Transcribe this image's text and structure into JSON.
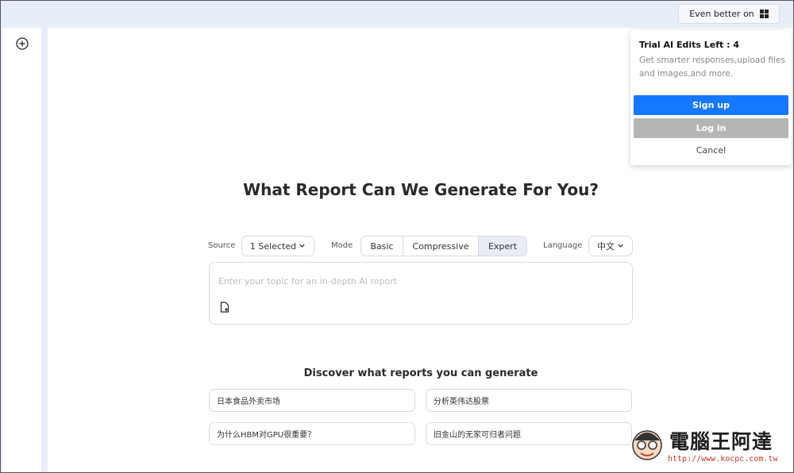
{
  "topbar": {
    "even_better_label": "Even better on",
    "even_better_icon": "windows-icon"
  },
  "left_rail": {
    "new_icon": "plus-circle-icon"
  },
  "main": {
    "title": "What Report Can We Generate For You?",
    "source": {
      "label": "Source",
      "value": "1 Selected"
    },
    "mode": {
      "label": "Mode",
      "options": [
        "Basic",
        "Compressive",
        "Expert"
      ],
      "selected": "Expert"
    },
    "language": {
      "label": "Language",
      "value": "中文"
    },
    "topic": {
      "placeholder": "Enter your topic for an in-depth AI report",
      "value": ""
    },
    "discover": {
      "title": "Discover what reports you can generate",
      "suggestions": [
        "日本食品外卖市场",
        "分析英伟达股票",
        "为什么HBM对GPU很重要？",
        "旧金山的无家可归者问题"
      ]
    }
  },
  "popup": {
    "title": "Trial AI Edits Left : 4",
    "description": "Get smarter responses,upload files and images,and more.",
    "signup_label": "Sign up",
    "login_label": "Log in",
    "cancel_label": "Cancel"
  },
  "watermark": {
    "name": "電腦王阿達",
    "url": "http://www.kocpc.com.tw"
  },
  "colors": {
    "accent": "#1677ff",
    "login_gray": "#b5b5b5",
    "background": "#e8eef9"
  }
}
